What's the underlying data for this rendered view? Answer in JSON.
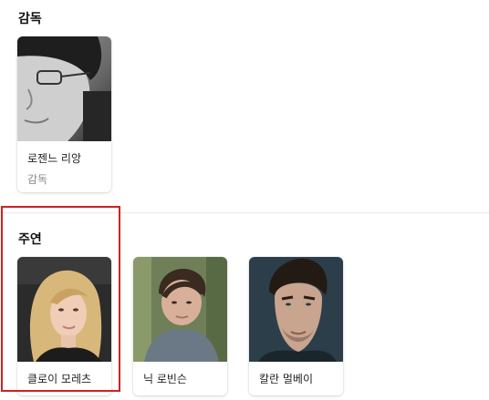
{
  "director_section": {
    "title": "감독",
    "people": [
      {
        "name": "로젠느 리앙",
        "role": "감독"
      }
    ]
  },
  "cast_section": {
    "title": "주연",
    "people": [
      {
        "name": "클로이 모레츠"
      },
      {
        "name": "닉 로빈슨"
      },
      {
        "name": "칼란 멀베이"
      }
    ]
  },
  "highlight_color": "#d42020"
}
